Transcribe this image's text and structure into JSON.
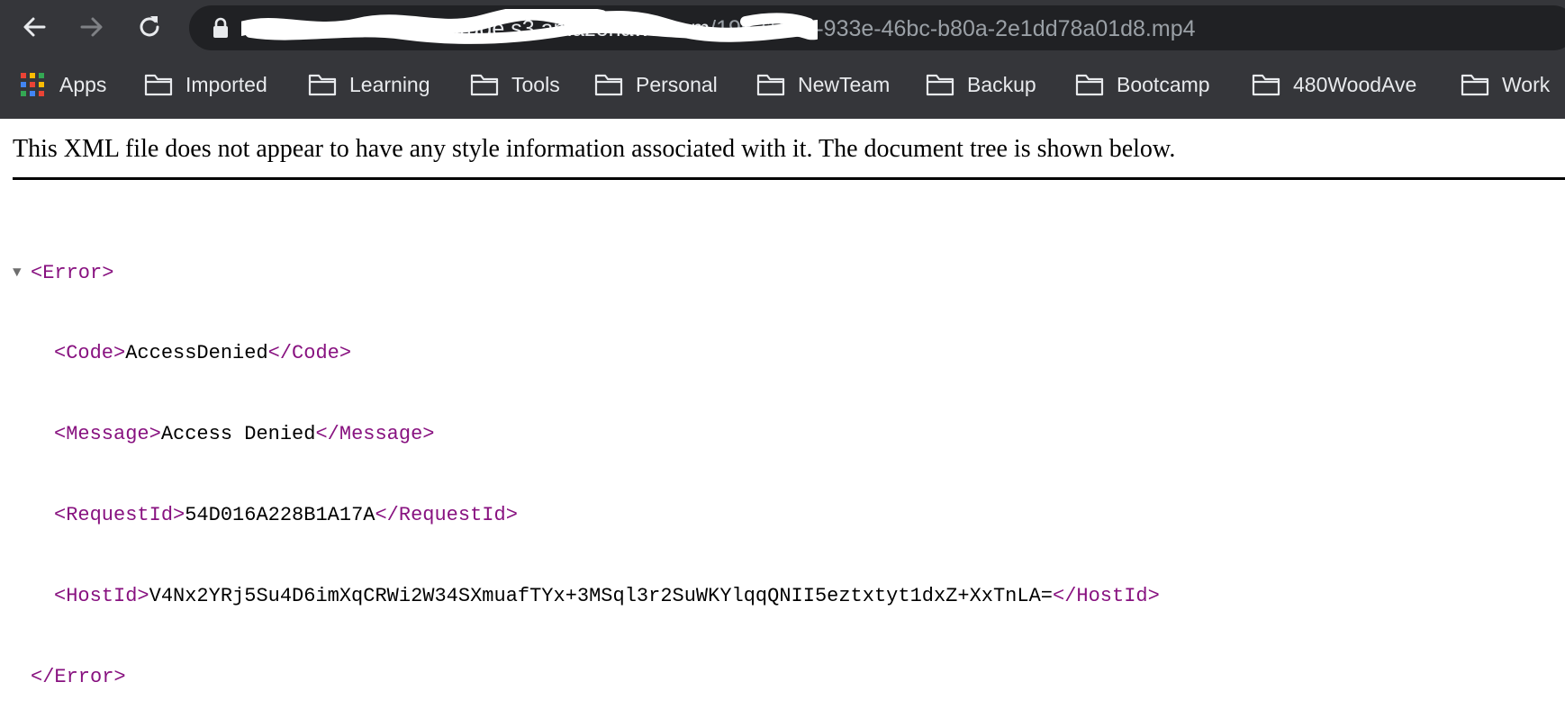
{
  "browser": {
    "url_prefix_redacted": "tenna-automation-storage.s3.amazonaws.com",
    "url_path": "/196216a2-933e-46bc-b80a-2e1dd78a01d8.mp4",
    "bookmarks": [
      {
        "label": "Apps",
        "icon": "apps-grid-icon"
      },
      {
        "label": "Imported",
        "icon": "folder-icon"
      },
      {
        "label": "Learning",
        "icon": "folder-icon"
      },
      {
        "label": "Tools",
        "icon": "folder-icon"
      },
      {
        "label": "Personal",
        "icon": "folder-icon"
      },
      {
        "label": "NewTeam",
        "icon": "folder-icon"
      },
      {
        "label": "Backup",
        "icon": "folder-icon"
      },
      {
        "label": "Bootcamp",
        "icon": "folder-icon"
      },
      {
        "label": "480WoodAve",
        "icon": "folder-icon"
      },
      {
        "label": "Work",
        "icon": "folder-icon"
      }
    ]
  },
  "page": {
    "notice": "This XML file does not appear to have any style information associated with it. The document tree is shown below.",
    "xml": {
      "root_open": "<Error>",
      "root_close": "</Error>",
      "code": {
        "open": "<Code>",
        "value": "AccessDenied",
        "close": "</Code>"
      },
      "message": {
        "open": "<Message>",
        "value": "Access Denied",
        "close": "</Message>"
      },
      "request_id": {
        "open": "<RequestId>",
        "value": "54D016A228B1A17A",
        "close": "</RequestId>"
      },
      "host_id": {
        "open": "<HostId>",
        "value": "V4Nx2YRj5Su4D6imXqCRWi2W34SXmuafTYx+3MSql3r2SuWKYlqqQNII5eztxtyt1dxZ+XxTnLA=",
        "close": "</HostId>"
      }
    }
  },
  "colors": {
    "chrome_bg": "#35363a",
    "omnibox_bg": "#202124",
    "xml_tag": "#881280"
  }
}
